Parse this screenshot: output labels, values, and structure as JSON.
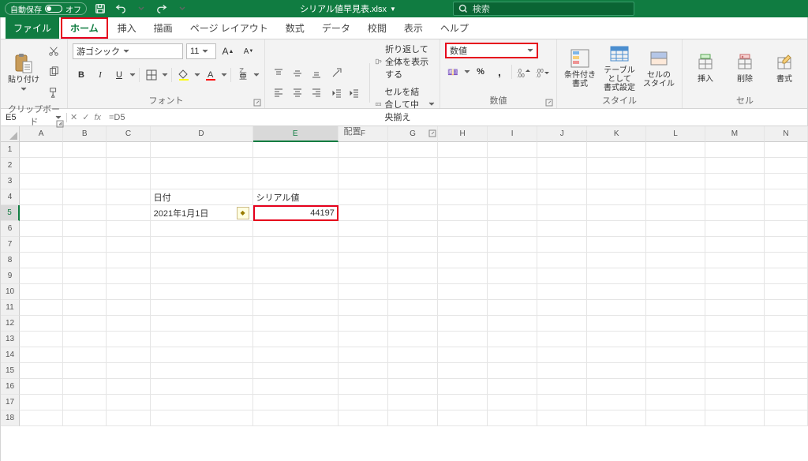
{
  "titlebar": {
    "autosave_label": "自動保存",
    "autosave_state": "オフ",
    "filename": "シリアル値早見表.xlsx",
    "search_placeholder": "検索"
  },
  "tabs": {
    "file": "ファイル",
    "home": "ホーム",
    "insert": "挿入",
    "draw": "描画",
    "pagelayout": "ページ レイアウト",
    "formulas": "数式",
    "data": "データ",
    "review": "校閲",
    "view": "表示",
    "help": "ヘルプ"
  },
  "ribbon": {
    "clipboard": {
      "paste": "貼り付け",
      "label": "クリップボード"
    },
    "font": {
      "name": "游ゴシック",
      "size": "11",
      "label": "フォント"
    },
    "alignment": {
      "wrap": "折り返して全体を表示する",
      "merge": "セルを結合して中央揃え",
      "label": "配置"
    },
    "number": {
      "format": "数値",
      "label": "数値"
    },
    "styles": {
      "conditional": "条件付き\n書式",
      "table": "テーブルとして\n書式設定",
      "cellstyles": "セルの\nスタイル",
      "label": "スタイル"
    },
    "cells": {
      "insert": "挿入",
      "delete": "削除",
      "format": "書式",
      "label": "セル"
    }
  },
  "formula_bar": {
    "namebox": "E5",
    "formula": "=D5"
  },
  "columns": [
    "A",
    "B",
    "C",
    "D",
    "E",
    "F",
    "G",
    "H",
    "I",
    "J",
    "K",
    "L",
    "M",
    "N"
  ],
  "rows": [
    "1",
    "2",
    "3",
    "4",
    "5",
    "6",
    "7",
    "8",
    "9",
    "10",
    "11",
    "12",
    "13",
    "14",
    "15",
    "16",
    "17",
    "18"
  ],
  "cell_data": {
    "D4": "日付",
    "E4": "シリアル値",
    "D5": "2021年1月1日",
    "E5": "44197"
  },
  "selected_cell": "E5",
  "highlight_color": "#e6001c"
}
